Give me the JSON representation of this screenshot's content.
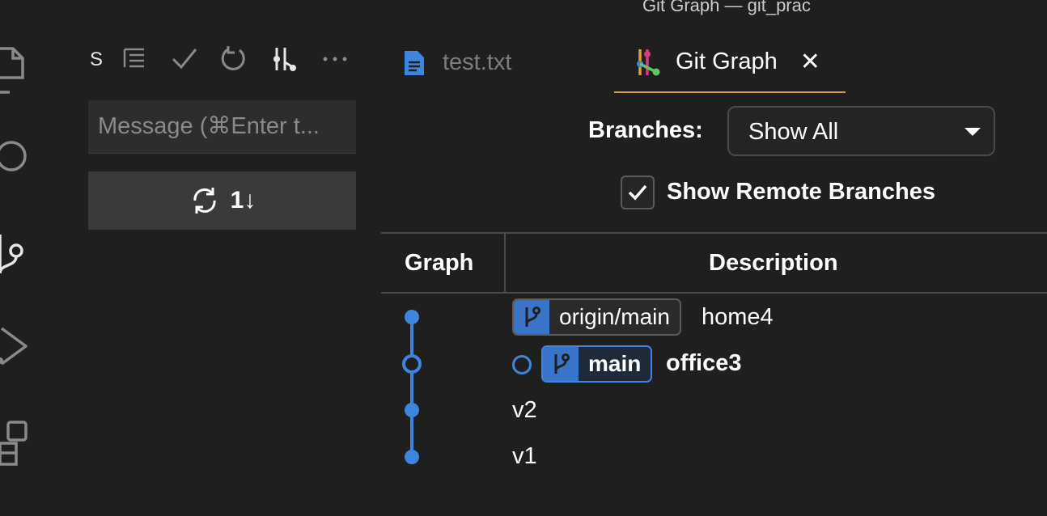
{
  "window": {
    "title": "Git Graph — git_prac",
    "traffic_colors": [
      "#febc2e",
      "#28c840"
    ]
  },
  "sidebar": {
    "title": "S",
    "commit_placeholder": "Message (⌘Enter t...",
    "sync_count": "1↓"
  },
  "tabs": [
    {
      "label": "test.txt",
      "active": false
    },
    {
      "label": "Git Graph",
      "active": true
    }
  ],
  "controls": {
    "branches_label": "Branches:",
    "branches_value": "Show All",
    "show_remote_label": "Show Remote Branches",
    "show_remote_checked": true
  },
  "table": {
    "headers": {
      "graph": "Graph",
      "description": "Description"
    },
    "commits": [
      {
        "message": "home4",
        "refs": [
          "origin/main"
        ]
      },
      {
        "message": "office3",
        "refs": [
          "main"
        ],
        "head": true
      },
      {
        "message": "v2",
        "refs": []
      },
      {
        "message": "v1",
        "refs": []
      }
    ]
  },
  "colors": {
    "accent": "#3d86e0",
    "graph_line": "#3d86e0",
    "tab_underline": "#e09e3e"
  }
}
